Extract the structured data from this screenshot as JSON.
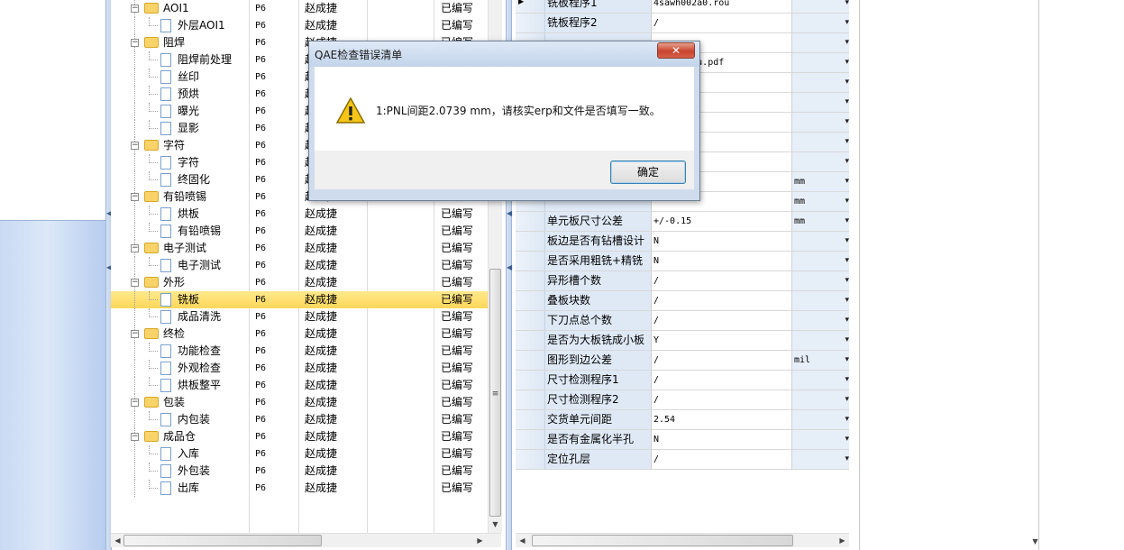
{
  "tree_rows": [
    {
      "label": "AOI1",
      "level": 1,
      "type": "folder",
      "c1": "P6",
      "c2": "赵成捷",
      "c4": "已编写"
    },
    {
      "label": "外层AOI1",
      "level": 2,
      "type": "doc",
      "c1": "P6",
      "c2": "赵成捷",
      "c4": "已编写"
    },
    {
      "label": "阻焊",
      "level": 1,
      "type": "folder",
      "c1": "P6",
      "c2": "赵成捷",
      "c4": "已编写"
    },
    {
      "label": "阻焊前处理",
      "level": 2,
      "type": "doc",
      "c1": "P6",
      "c2": "赵成捷",
      "c4": "已编写"
    },
    {
      "label": "丝印",
      "level": 2,
      "type": "doc",
      "c1": "P6",
      "c2": "赵成捷",
      "c4": "已编写"
    },
    {
      "label": "预烘",
      "level": 2,
      "type": "doc",
      "c1": "P6",
      "c2": "赵成捷",
      "c4": "已编写"
    },
    {
      "label": "曝光",
      "level": 2,
      "type": "doc",
      "c1": "P6",
      "c2": "赵成捷",
      "c4": "已编写"
    },
    {
      "label": "显影",
      "level": 2,
      "type": "doc",
      "c1": "P6",
      "c2": "赵成捷",
      "c4": "已编写"
    },
    {
      "label": "字符",
      "level": 1,
      "type": "folder",
      "c1": "P6",
      "c2": "赵成捷",
      "c4": "已编写"
    },
    {
      "label": "字符",
      "level": 2,
      "type": "doc",
      "c1": "P6",
      "c2": "赵成捷",
      "c4": "已编写"
    },
    {
      "label": "终固化",
      "level": 2,
      "type": "doc",
      "c1": "P6",
      "c2": "赵成捷",
      "c4": "已编写"
    },
    {
      "label": "有铅喷锡",
      "level": 1,
      "type": "folder",
      "c1": "P6",
      "c2": "赵成捷",
      "c4": "已编写"
    },
    {
      "label": "烘板",
      "level": 2,
      "type": "doc",
      "c1": "P6",
      "c2": "赵成捷",
      "c4": "已编写"
    },
    {
      "label": "有铅喷锡",
      "level": 2,
      "type": "doc",
      "c1": "P6",
      "c2": "赵成捷",
      "c4": "已编写"
    },
    {
      "label": "电子测试",
      "level": 1,
      "type": "folder",
      "c1": "P6",
      "c2": "赵成捷",
      "c4": "已编写"
    },
    {
      "label": "电子测试",
      "level": 2,
      "type": "doc",
      "c1": "P6",
      "c2": "赵成捷",
      "c4": "已编写"
    },
    {
      "label": "外形",
      "level": 1,
      "type": "folder",
      "c1": "P6",
      "c2": "赵成捷",
      "c4": "已编写"
    },
    {
      "label": "铣板",
      "level": 2,
      "type": "doc",
      "c1": "P6",
      "c2": "赵成捷",
      "c4": "已编写",
      "selected": true
    },
    {
      "label": "成品清洗",
      "level": 2,
      "type": "doc",
      "c1": "P6",
      "c2": "赵成捷",
      "c4": "已编写"
    },
    {
      "label": "终检",
      "level": 1,
      "type": "folder",
      "c1": "P6",
      "c2": "赵成捷",
      "c4": "已编写"
    },
    {
      "label": "功能检查",
      "level": 2,
      "type": "doc",
      "c1": "P6",
      "c2": "赵成捷",
      "c4": "已编写"
    },
    {
      "label": "外观检查",
      "level": 2,
      "type": "doc",
      "c1": "P6",
      "c2": "赵成捷",
      "c4": "已编写"
    },
    {
      "label": "烘板整平",
      "level": 2,
      "type": "doc",
      "c1": "P6",
      "c2": "赵成捷",
      "c4": "已编写"
    },
    {
      "label": "包装",
      "level": 1,
      "type": "folder",
      "c1": "P6",
      "c2": "赵成捷",
      "c4": "已编写"
    },
    {
      "label": "内包装",
      "level": 2,
      "type": "doc",
      "c1": "P6",
      "c2": "赵成捷",
      "c4": "已编写"
    },
    {
      "label": "成品仓",
      "level": 1,
      "type": "folder",
      "c1": "P6",
      "c2": "赵成捷",
      "c4": "已编写"
    },
    {
      "label": "入库",
      "level": 2,
      "type": "doc",
      "c1": "P6",
      "c2": "赵成捷",
      "c4": "已编写"
    },
    {
      "label": "外包装",
      "level": 2,
      "type": "doc",
      "c1": "P6",
      "c2": "赵成捷",
      "c4": "已编写"
    },
    {
      "label": "出库",
      "level": 2,
      "type": "doc",
      "c1": "P6",
      "c2": "赵成捷",
      "c4": "已编写"
    }
  ],
  "grid_rows": [
    {
      "name": "铣板程序1",
      "value": "4sawh002a0.rou",
      "unit": "",
      "current": true
    },
    {
      "name": "铣板程序2",
      "value": "/",
      "unit": ""
    },
    {
      "name": "",
      "value": "",
      "unit": ""
    },
    {
      "name": "",
      "value": "0_biaozhu.pdf",
      "unit": ""
    },
    {
      "name": "",
      "value": "",
      "unit": ""
    },
    {
      "name": "",
      "value": "",
      "unit": ""
    },
    {
      "name": "",
      "value": "",
      "unit": ""
    },
    {
      "name": "",
      "value": "",
      "unit": ""
    },
    {
      "name": "",
      "value": "",
      "unit": ""
    },
    {
      "name": "",
      "value": "",
      "unit": "mm"
    },
    {
      "name": "",
      "value": "",
      "unit": "mm"
    },
    {
      "name": "单元板尺寸公差",
      "value": "+/-0.15",
      "unit": "mm"
    },
    {
      "name": "板边是否有钻槽设计",
      "value": "N",
      "unit": ""
    },
    {
      "name": "是否采用粗铣+精铣",
      "value": "N",
      "unit": ""
    },
    {
      "name": "异形槽个数",
      "value": "/",
      "unit": ""
    },
    {
      "name": "叠板块数",
      "value": "/",
      "unit": ""
    },
    {
      "name": "下刀点总个数",
      "value": "/",
      "unit": ""
    },
    {
      "name": "是否为大板铣成小板",
      "value": "Y",
      "unit": ""
    },
    {
      "name": "图形到边公差",
      "value": "/",
      "unit": "mil"
    },
    {
      "name": "尺寸检测程序1",
      "value": "/",
      "unit": ""
    },
    {
      "name": "尺寸检测程序2",
      "value": "/",
      "unit": ""
    },
    {
      "name": "交货单元间距",
      "value": "2.54",
      "unit": ""
    },
    {
      "name": "是否有金属化半孔",
      "value": "N",
      "unit": ""
    },
    {
      "name": "定位孔层",
      "value": "/",
      "unit": ""
    }
  ],
  "dialog": {
    "title": "QAE检查错误清单",
    "close_label": "✕",
    "message": "1:PNL间距2.0739 mm，请核实erp和文件是否填写一致。",
    "ok_label": "确定"
  },
  "icons": {
    "dialog_icon": "warning-icon",
    "folder": "folder-icon",
    "document": "document-icon"
  },
  "colors": {
    "selection": "#ffd75a",
    "dialog_frame": "#cfdced",
    "grid_name_bg": "#dfe9f6"
  }
}
